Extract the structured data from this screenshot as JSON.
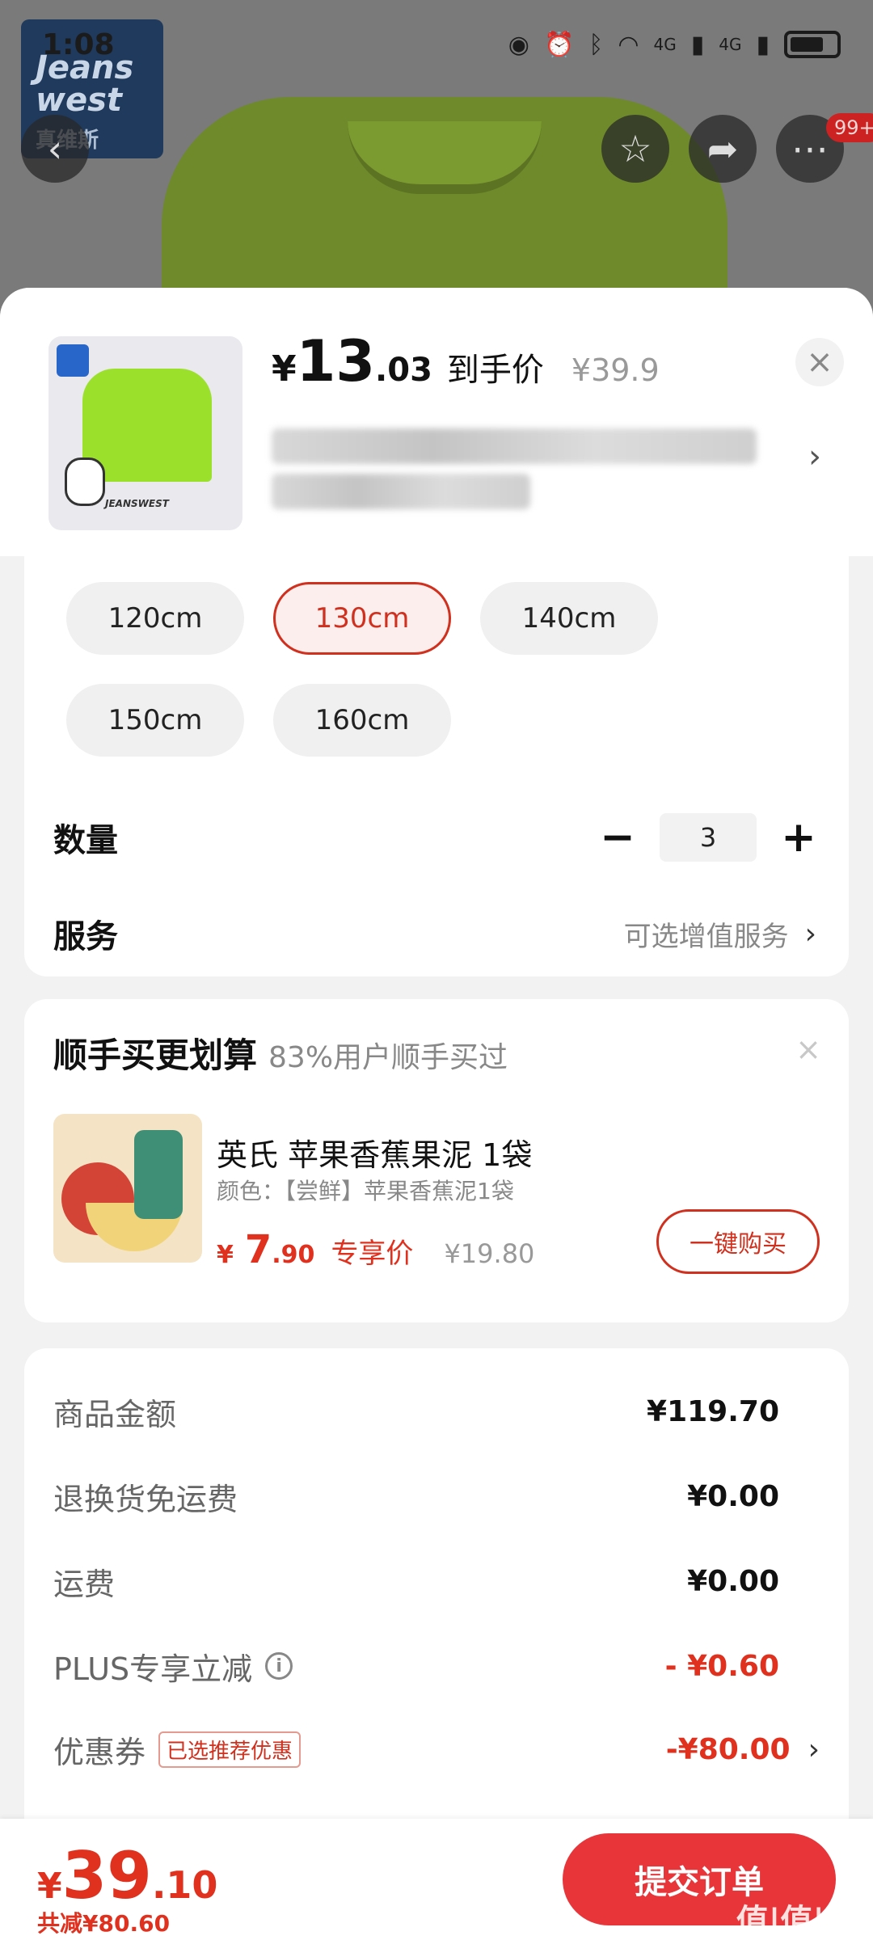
{
  "status_bar": {
    "time": "1:08",
    "network": "4G",
    "network2": "4G"
  },
  "background": {
    "brand_logo": "Jeans west",
    "brand_sub": "真维斯",
    "badge": "99+"
  },
  "product": {
    "price_currency": "¥",
    "price_int": "13",
    "price_dec": ".03",
    "price_label": "到手价",
    "original_price": "¥39.9"
  },
  "specs": {
    "sizes": [
      "120cm",
      "130cm",
      "140cm",
      "150cm",
      "160cm"
    ],
    "selected_size": "130cm",
    "quantity_label": "数量",
    "quantity": "3",
    "service_label": "服务",
    "service_value": "可选增值服务"
  },
  "upsell": {
    "title": "顺手买更划算",
    "subtitle": "83%用户顺手买过",
    "item_name": "英氏 苹果香蕉果泥 1袋",
    "item_spec": "颜色：【尝鲜】苹果香蕉泥1袋",
    "price_currency": "¥",
    "price_int": "7",
    "price_dec": ".90",
    "price_label": "专享价",
    "original_price": "¥19.80",
    "buy_button": "一键购买"
  },
  "summary": {
    "rows": [
      {
        "label": "商品金额",
        "value": "¥119.70"
      },
      {
        "label": "退换货免运费",
        "value": "¥0.00"
      },
      {
        "label": "运费",
        "value": "¥0.00"
      },
      {
        "label": "PLUS专享立减",
        "value": "- ¥0.60"
      },
      {
        "label": "优惠券",
        "tag": "已选推荐优惠",
        "value": "-¥80.00"
      }
    ]
  },
  "footer": {
    "total_currency": "¥",
    "total_int": "39",
    "total_dec": ".10",
    "saved": "共减¥80.60",
    "submit": "提交订单",
    "watermark": "值|值|值"
  },
  "colors": {
    "accent": "#e0301e",
    "submit": "#e8353a"
  }
}
